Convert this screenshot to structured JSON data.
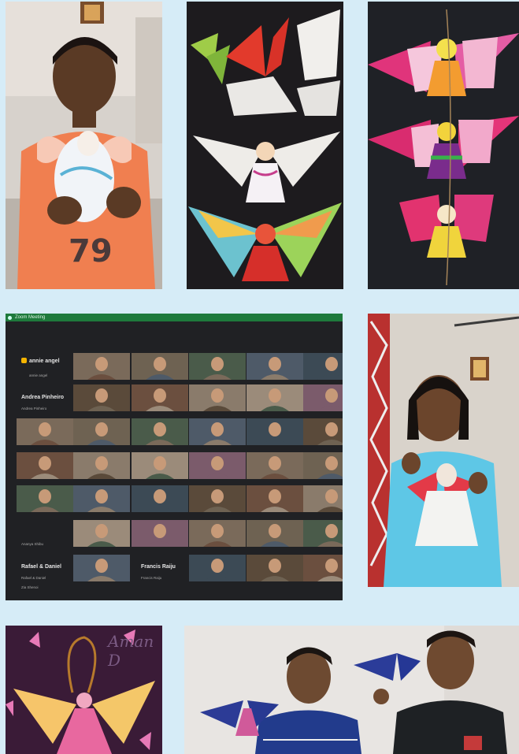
{
  "call": {
    "window_title": "Zoom Meeting",
    "participants_row1": [
      "annie angel",
      "Andrea Pinheiro"
    ],
    "subnames_row1": [
      "annie angel",
      "Andrea Pinheiro"
    ],
    "bottom_names": [
      "Rafael & Daniel",
      "Francis Raiju"
    ],
    "bottom_subnames": [
      "Rafael & Daniel",
      "Francis Raiju"
    ],
    "misc_label_left": "Zia Shenoi",
    "misc_label_mid": "Ananya Shibu"
  },
  "caption_aman": "Aman D",
  "colors": {
    "background": "#d6ecf7",
    "call_bar": "#1e7a3c",
    "call_bg": "#202124"
  }
}
